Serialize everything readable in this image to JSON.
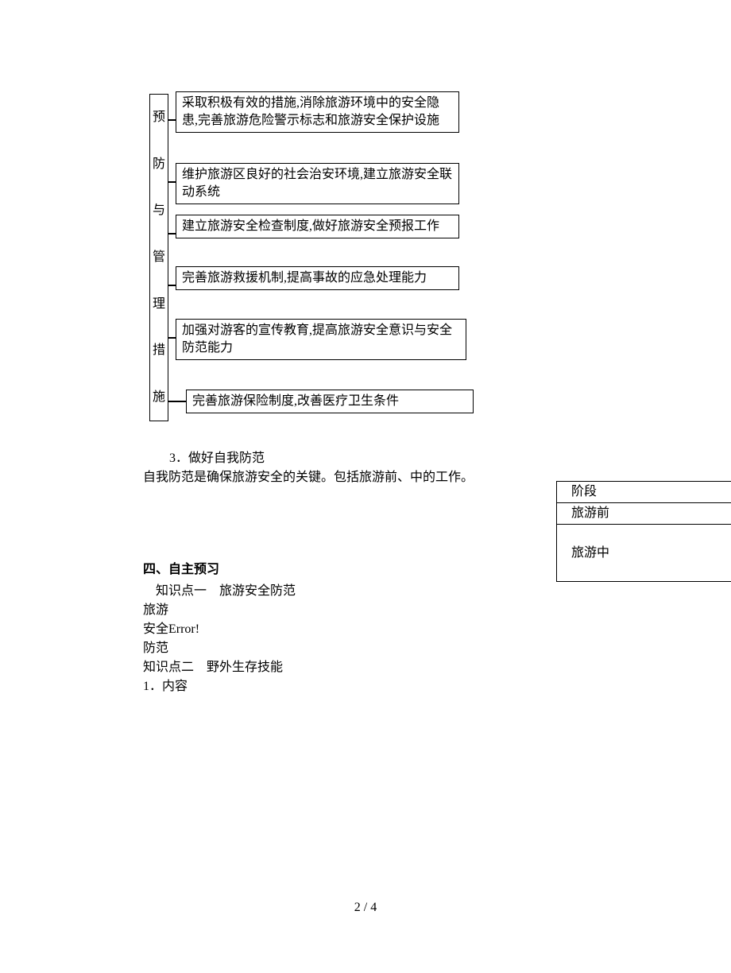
{
  "diagram": {
    "label_chars": [
      "预",
      "防",
      "与",
      "管",
      "理",
      "措",
      "施"
    ],
    "boxes": [
      "采取积极有效的措施,消除旅游环境中的安全隐患,完善旅游危险警示标志和旅游安全保护设施",
      "维护旅游区良好的社会治安环境,建立旅游安全联动系统",
      "建立旅游安全检查制度,做好旅游安全预报工作",
      "完善旅游救援机制,提高事故的应急处理能力",
      "加强对游客的宣传教育,提高旅游安全意识与安全防范能力",
      "完善旅游保险制度,改善医疗卫生条件"
    ]
  },
  "paragraph3": {
    "title": "3．做好自我防范",
    "body": "自我防范是确保旅游安全的关键。包括旅游前、中的工作。"
  },
  "side_table": {
    "rows": [
      "阶段",
      "旅游前",
      "旅游中"
    ]
  },
  "section4": {
    "heading": "四、自主预习",
    "kp1_title": "知识点一　旅游安全防范",
    "lines": [
      "旅游",
      "安全Error!",
      "防范"
    ],
    "kp2_title": "知识点二　野外生存技能",
    "item": "1．内容"
  },
  "page_number": "2 / 4"
}
